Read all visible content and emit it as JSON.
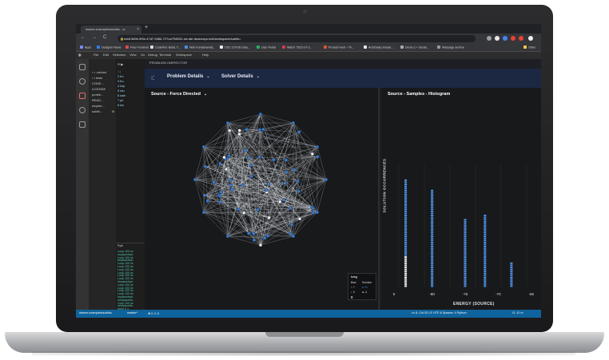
{
  "browser": {
    "tab_title": "dwave-examples/subtitu - w",
    "tab_close": "×",
    "new_tab": "+",
    "nav": {
      "back": "←",
      "forward": "→",
      "reload": "C"
    },
    "url": "edd13d9b-9f3e-47d7-9486-727ca7945f11.ws.ide.dwavesys.io/#/workspace/subtitu",
    "bookmarks": [
      {
        "label": "Apps",
        "color": "#7b8cff"
      },
      {
        "label": "Designer News",
        "color": "#2f80ed"
      },
      {
        "label": "Free Frontend",
        "color": "#e24b4b"
      },
      {
        "label": "CodePen: Build, T...",
        "color": "#dddddd"
      },
      {
        "label": "Web Fundamental...",
        "color": "#4a90e2"
      },
      {
        "label": "CDC COVID Data...",
        "color": "#eeeeee"
      },
      {
        "label": "User Portal",
        "color": "#27ae60"
      },
      {
        "label": "Watch \"2021-07-2...",
        "color": "#d73a49"
      },
      {
        "label": "Product Hunt – Th...",
        "color": "#da552f"
      },
      {
        "label": "ArchDaily | Broad...",
        "color": "#e8e8e8"
      },
      {
        "label": "Demo 2 + Social...",
        "color": "#aaaaaa"
      },
      {
        "label": "Webpage archive",
        "color": "#999999"
      },
      {
        "label": "Other",
        "color": "#f2c94c"
      }
    ]
  },
  "ide": {
    "menu": [
      "File",
      "Edit",
      "Selection",
      "View",
      "Go",
      "Debug",
      "Terminal",
      "Workspace",
      "Help"
    ],
    "explorer_items": [
      ".circleci",
      "tests",
      "CODE...",
      "LICENSE",
      "proble...",
      "READ...",
      "require...",
      "subtit..."
    ],
    "explorer_modified_badge": "M",
    "terminal_tab": "Pyth",
    "terminal_lines": [
      "Loop 100 /w",
      "rkspace/sub",
      "Loop 100 /w",
      "rkspace/sub",
      "Loop 100 /w",
      "Loop 100 /w",
      "Loop 100 /w",
      "Loop 100 /w",
      "Loop 100 /w",
      "Loop 100 /w",
      "rkspace/sub",
      "Loop 100 /w",
      "Loop 100 /w",
      "Loop 100 /w",
      "Loop 100 /w",
      "rkspace/sub",
      "orkspace/su",
      "Loop 100 /w",
      "orkspace/su",
      "done 0.1"
    ],
    "statusbar": {
      "left": "dwave-examples/subtitu",
      "branch": "master*",
      "counts": "⊗ 0 ⚠ 0",
      "right": "Ln 8, Col 52    LF    UTF-8    Spaces: 4    Python",
      "cloud": "O: 12 m"
    }
  },
  "inspector": {
    "header": "PROBLEM INSPECTOR",
    "problem_details": "Problem Details",
    "solver_details": "Solver Details",
    "chevron": "⌄",
    "left_pane_title": "Source - Force Directed",
    "right_pane_title": "Source - Samples - Histogram",
    "legend": {
      "title": "Ising",
      "col1": "Bias",
      "col2": "Solution",
      "row1": [
        "+",
        "+1"
      ],
      "row2": [
        "0",
        "-1"
      ],
      "row3": "0"
    }
  },
  "chart_data": {
    "type": "bar",
    "title": "Source - Samples - Histogram",
    "xlabel": "ENERGY (SOURCE)",
    "ylabel": "SOLUTION OCCURRENCES",
    "xtick_labels": [
      "5",
      "-80",
      "-75",
      "-70",
      "-65"
    ],
    "series": [
      {
        "name": "samples",
        "x": [
          -84,
          -80,
          -75,
          -72,
          -68
        ],
        "values": [
          70,
          63,
          44,
          47,
          16
        ]
      }
    ],
    "highlight": {
      "x": -84,
      "value": 20
    },
    "colors": {
      "bar": "#4c8fe0",
      "highlight": "#e8e8e8"
    }
  },
  "graph": {
    "node_color": "#3c7dd1",
    "edge_color": "#e8ecf3",
    "node_count": 72
  }
}
